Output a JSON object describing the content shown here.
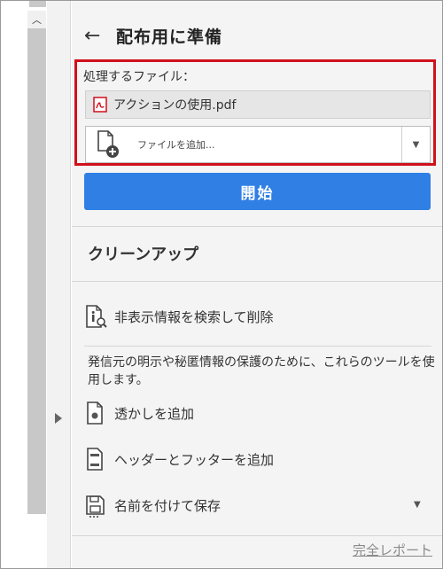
{
  "panel": {
    "title": "配布用に準備",
    "back_label": "←"
  },
  "files": {
    "label": "処理するファイル：",
    "items": [
      {
        "name": "アクションの使用.pdf"
      }
    ],
    "add_label": "ファイルを追加..."
  },
  "start_button": "開始",
  "cleanup": {
    "title": "クリーンアップ",
    "find_remove": "非表示情報を検索して削除",
    "description": "発信元の明示や秘匿情報の保護のために、これらのツールを使用します。",
    "tools": [
      {
        "label": "透かしを追加",
        "icon": "watermark-icon"
      },
      {
        "label": "ヘッダーとフッターを追加",
        "icon": "header-footer-icon"
      },
      {
        "label": "名前を付けて保存",
        "icon": "save-icon"
      }
    ]
  },
  "report_link": "完全レポート",
  "colors": {
    "highlight_border": "#d1101a",
    "start_button": "#2f7fe5",
    "pdf_icon": "#d1101a"
  }
}
